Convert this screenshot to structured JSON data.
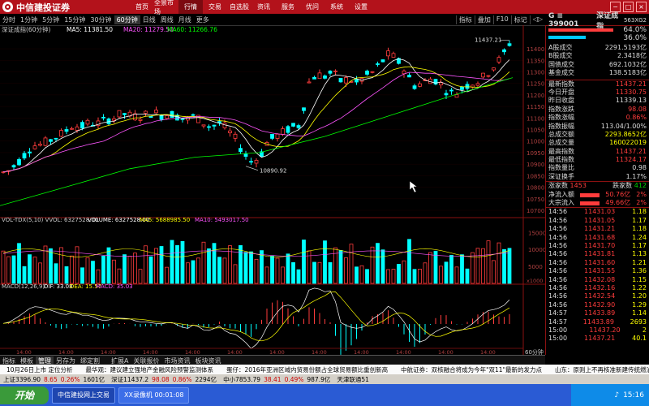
{
  "app": {
    "brand": "中信建投证券",
    "nav": [
      "首页",
      "全景市场",
      "行情",
      "交易",
      "自选股",
      "资讯",
      "服务",
      "优问",
      "系统",
      "设置"
    ],
    "nav_active": 2
  },
  "periods": [
    "分时",
    "1分钟",
    "5分钟",
    "15分钟",
    "30分钟",
    "60分钟",
    "日线",
    "周线",
    "月线",
    "更多"
  ],
  "period_active": 5,
  "tools": [
    "指标",
    "叠加",
    "F10",
    "标记",
    "◁▷"
  ],
  "main_chart": {
    "caption_name": "深证成指(60分钟)",
    "ma5": "MA5: 11381.50",
    "ma10": "MA10: 11338.10",
    "ma20": "MA20: 11279.50",
    "ma60": "MA60: 11266.76",
    "high_label": "11437.21",
    "low_label": "10890.92",
    "y_ticks": [
      "11400",
      "11350",
      "11300",
      "11250",
      "11200",
      "11150",
      "11100",
      "11050",
      "11000",
      "10950",
      "10900",
      "10850",
      "10800",
      "10750",
      "10700"
    ]
  },
  "vol_chart": {
    "caption": "VOL-TDX(5,10) VVOL: 6327528.00",
    "volume": "VOLUME: 6327528.00",
    "ma5": "MA5: 5688985.50",
    "ma10": "MA10: 5493017.50",
    "y_ticks": [
      "15000",
      "10000",
      "5000"
    ],
    "unit": "x1000"
  },
  "macd_chart": {
    "caption": "MACD(12,26,9)",
    "dif": "DIF: 33.08",
    "dea": "DEA: 15.57",
    "macd": "MACD: 35.03",
    "x_ticks": [
      "14:00",
      "14:00",
      "14:00",
      "14:00",
      "14:00",
      "14:00",
      "14:00",
      "14:00",
      "14:00",
      "14:00",
      "14:00",
      "14:00"
    ],
    "period_label": "60分钟"
  },
  "quote": {
    "code": "G ≡ 399001",
    "name": "深证成指",
    "extra": "563XG2",
    "bar1": "64.0%",
    "bar2": "36.0%",
    "rows_a": [
      {
        "k": "A股成交",
        "v": "2291.5193亿"
      },
      {
        "k": "B股成交",
        "v": "2.3418亿"
      },
      {
        "k": "国债成交",
        "v": "692.1032亿"
      },
      {
        "k": "基金成交",
        "v": "138.5183亿"
      }
    ],
    "rows_b": [
      {
        "k": "最新指数",
        "v": "11437.21",
        "c": "red"
      },
      {
        "k": "今日开盘",
        "v": "11330.75",
        "c": "red"
      },
      {
        "k": "昨日收盘",
        "v": "11339.13",
        "c": "white"
      },
      {
        "k": "指数涨跌",
        "v": "98.08",
        "c": "red"
      },
      {
        "k": "指数涨幅",
        "v": "0.86%",
        "c": "red"
      },
      {
        "k": "指数振幅",
        "v": "113.04/1.00%",
        "c": "white"
      },
      {
        "k": "总成交额",
        "v": "2293.8652亿",
        "c": "yellow"
      },
      {
        "k": "总成交量",
        "v": "160022019",
        "c": "yellow"
      },
      {
        "k": "最高指数",
        "v": "11437.21",
        "c": "red"
      },
      {
        "k": "最低指数",
        "v": "11324.17",
        "c": "red"
      },
      {
        "k": "指数量比",
        "v": "0.98",
        "c": "white"
      },
      {
        "k": "深证换手",
        "v": "1.17%",
        "c": "white"
      }
    ],
    "updown": {
      "up_label": "涨家数",
      "up": "1453",
      "down_label": "跌家数",
      "down": "412"
    },
    "flows": [
      {
        "k": "净流入额",
        "v": "50.76亿",
        "p": "2%"
      },
      {
        "k": "大宗流入",
        "v": "49.66亿",
        "p": "2%"
      }
    ],
    "ticks": [
      {
        "t": "14:56",
        "p": "11431.03",
        "v": "1.18"
      },
      {
        "t": "14:56",
        "p": "11431.05",
        "v": "1.17"
      },
      {
        "t": "14:56",
        "p": "11431.21",
        "v": "1.18"
      },
      {
        "t": "14:56",
        "p": "11431.68",
        "v": "1.24"
      },
      {
        "t": "14:56",
        "p": "11431.70",
        "v": "1.17"
      },
      {
        "t": "14:56",
        "p": "11431.81",
        "v": "1.13"
      },
      {
        "t": "14:56",
        "p": "11431.60",
        "v": "1.21"
      },
      {
        "t": "14:56",
        "p": "11431.55",
        "v": "1.36"
      },
      {
        "t": "14:56",
        "p": "11432.08",
        "v": "1.15"
      },
      {
        "t": "14:56",
        "p": "11432.16",
        "v": "1.22"
      },
      {
        "t": "14:56",
        "p": "11432.54",
        "v": "1.20"
      },
      {
        "t": "14:56",
        "p": "11432.90",
        "v": "1.29"
      },
      {
        "t": "14:57",
        "p": "11433.89",
        "v": "1.14"
      },
      {
        "t": "14:57",
        "p": "11433.89",
        "v": "2693"
      },
      {
        "t": "15:00",
        "p": "11437.20",
        "v": "2"
      },
      {
        "t": "15:00",
        "p": "11437.21",
        "v": "40.1"
      }
    ]
  },
  "bottom_tabs": [
    "指标",
    "模板",
    "管理",
    "另存为",
    "绑定割"
  ],
  "bottom_tab_active": 2,
  "sub_tabs": [
    "扩展A",
    "关联报价",
    "市场资讯",
    "板块资讯"
  ],
  "news": [
    "10月26日上市 定位分析",
    "最华观：建议建立强地产金融风险预警监测体系",
    "蛋仔：2016年亚洲区域内贸易份额占全球贸易额比重创新高",
    "中航证券：双核融合将成为今年\"双11\"最新的发力点",
    "山东：原则上不再核准新建传统燃油汽车生产企业"
  ],
  "index_bar": {
    "sh": "上证3396.90",
    "sh_chg": "8.65",
    "sh_pct": "0.26%",
    "sh_amt": "1601亿",
    "sz": "深证11437.2",
    "sz_chg": "98.08",
    "sz_pct": "0.86%",
    "sz_amt": "2294亿",
    "cy": "中小7853.79",
    "cy_chg": "38.41",
    "cy_pct": "0.49%",
    "cy_amt": "987.9亿",
    "conn": "天津联通51"
  },
  "taskbar": {
    "start": "开始",
    "tasks": [
      "中信建投网上交易",
      "XX录像机 00:01:08"
    ],
    "time": "15:16"
  },
  "colors": {
    "up": "#ff3c3c",
    "down": "#00ffff",
    "ma5": "#ffffff",
    "ma10": "#ffff00",
    "ma20": "#ff55ff",
    "ma60": "#00ff00",
    "brand": "#b3121b"
  }
}
